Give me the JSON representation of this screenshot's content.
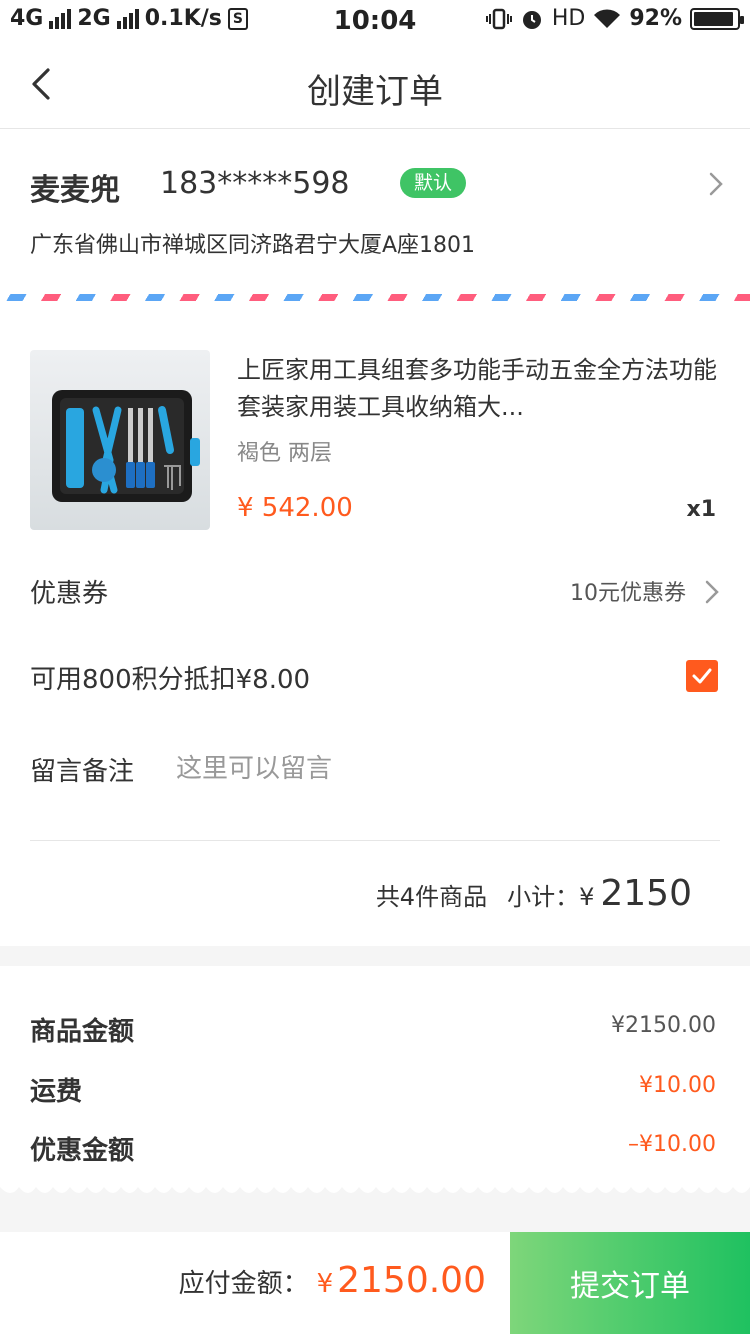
{
  "status_bar": {
    "network_1": "4G",
    "network_2": "2G",
    "speed": "0.1K/s",
    "sim_icon_text": "S",
    "time": "10:04",
    "hd": "HD",
    "battery_percent": "92%",
    "battery_level": 0.92
  },
  "nav": {
    "back_icon": "chevron-left-icon",
    "title": "创建订单"
  },
  "address": {
    "name": "麦麦兜",
    "phone": "183*****598",
    "badge": "默认",
    "detail": "广东省佛山市禅城区同济路君宁大厦A座1801"
  },
  "product": {
    "name": "上匠家用工具组套多功能手动五金全方法功能套装家用装工具收纳箱大...",
    "spec": "褐色   两层",
    "price": "¥ 542.00",
    "qty": "x1"
  },
  "coupon": {
    "label": "优惠券",
    "value": "10元优惠券"
  },
  "points": {
    "label": "可用800积分抵扣¥8.00",
    "checked": true
  },
  "remark": {
    "label": "留言备注",
    "placeholder": "这里可以留言"
  },
  "subtotal": {
    "count_text": "共4件商品",
    "label": "小计：",
    "currency": "¥",
    "amount": "2150"
  },
  "summary": {
    "items": [
      {
        "label": "商品金额",
        "value": "¥2150.00"
      },
      {
        "label": "运费",
        "value": "¥10.00"
      },
      {
        "label": "优惠金额",
        "value": "–¥10.00"
      }
    ]
  },
  "bottom": {
    "pay_label": "应付金额：",
    "currency": "¥",
    "amount": "2150.00",
    "submit_label": "提交订单"
  },
  "colors": {
    "accent_orange": "#ff5a1e",
    "green": "#1fc160",
    "badge_green": "#3fc465"
  }
}
